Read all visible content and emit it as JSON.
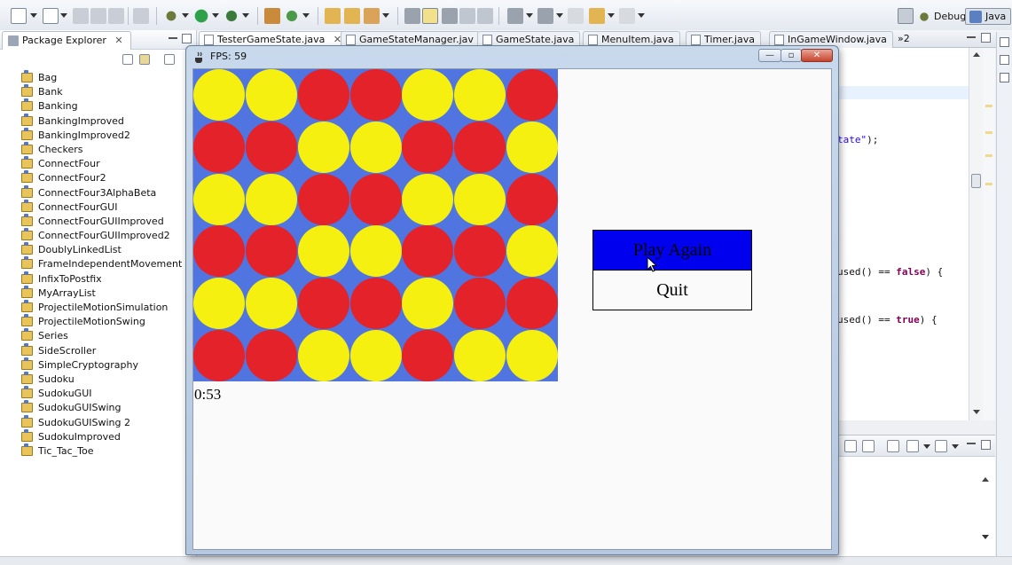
{
  "toolbar": {
    "perspectives": [
      {
        "label": "Debug",
        "active": false
      },
      {
        "label": "Java",
        "active": true
      }
    ]
  },
  "package_explorer": {
    "title": "Package Explorer",
    "projects": [
      "Bag",
      "Bank",
      "Banking",
      "BankingImproved",
      "BankingImproved2",
      "Checkers",
      "ConnectFour",
      "ConnectFour2",
      "ConnectFour3AlphaBeta",
      "ConnectFourGUI",
      "ConnectFourGUIImproved",
      "ConnectFourGUIImproved2",
      "DoublyLinkedList",
      "FrameIndependentMovement",
      "InfixToPostfix",
      "MyArrayList",
      "ProjectileMotionSimulation",
      "ProjectileMotionSwing",
      "Series",
      "SideScroller",
      "SimpleCryptography",
      "Sudoku",
      "SudokuGUI",
      "SudokuGUISwing",
      "SudokuGUISwing 2",
      "SudokuImproved",
      "Tic_Tac_Toe"
    ]
  },
  "editor": {
    "tabs": [
      {
        "label": "TesterGameState.java",
        "active": true
      },
      {
        "label": "GameStateManager.jav",
        "active": false
      },
      {
        "label": "GameState.java",
        "active": false
      },
      {
        "label": "MenuItem.java",
        "active": false
      },
      {
        "label": "Timer.java",
        "active": false
      },
      {
        "label": "InGameWindow.java",
        "active": false
      }
    ],
    "overflow_count": "»2",
    "code_fragments": {
      "line1_str": "tate\"",
      "line1_rest": ");",
      "line2_pre": "used() == ",
      "line2_kw": "false",
      "line2_post": ") {",
      "line3_pre": "used() == ",
      "line3_kw": "true",
      "line3_post": ") {"
    }
  },
  "game_window": {
    "title": "FPS: 59",
    "controls": {
      "minimize": "—",
      "restore": "▫",
      "close": "✕"
    },
    "board": {
      "rows": 6,
      "cols": 7,
      "colors": {
        "board": "#5074e0",
        "red": "#e3222a",
        "yellow": "#f5f010"
      },
      "cells": [
        [
          "Y",
          "Y",
          "R",
          "R",
          "Y",
          "Y",
          "R"
        ],
        [
          "R",
          "R",
          "Y",
          "Y",
          "R",
          "R",
          "Y"
        ],
        [
          "Y",
          "Y",
          "R",
          "R",
          "Y",
          "Y",
          "R"
        ],
        [
          "R",
          "R",
          "Y",
          "Y",
          "R",
          "R",
          "Y"
        ],
        [
          "Y",
          "Y",
          "R",
          "R",
          "Y",
          "R",
          "R"
        ],
        [
          "R",
          "R",
          "Y",
          "Y",
          "R",
          "Y",
          "Y"
        ]
      ]
    },
    "timer": "0:53",
    "menu": {
      "play_again": "Play Again",
      "quit": "Quit",
      "selected_color": "#0000ee"
    }
  }
}
